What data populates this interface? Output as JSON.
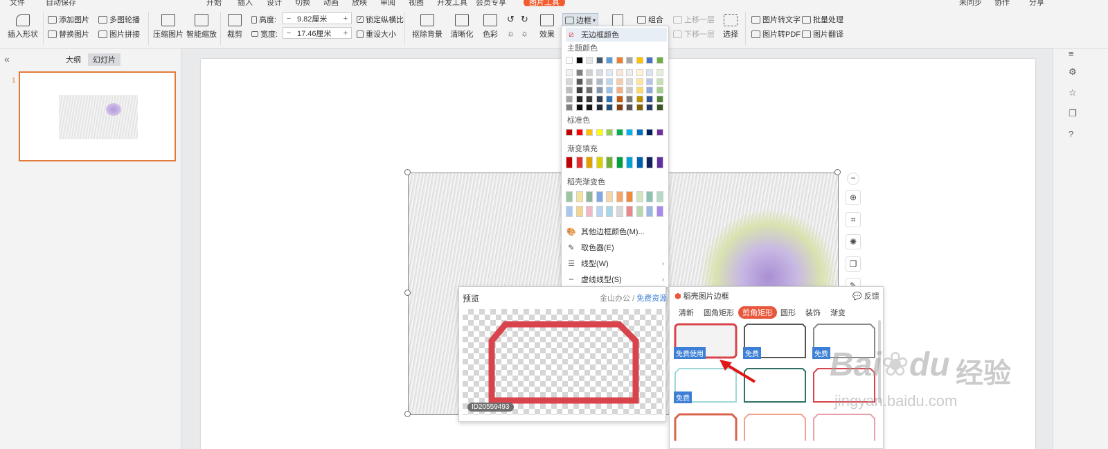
{
  "menubar": {
    "items": [
      "文件",
      "自动保存",
      "开始",
      "插入",
      "设计",
      "切换",
      "动画",
      "放映",
      "审阅",
      "视图",
      "开发工具",
      "会员专享",
      "图片工具"
    ],
    "right_items": [
      "未同步",
      "协作",
      "分享"
    ]
  },
  "ribbon": {
    "insert_shape": "插入形状",
    "add_picture": "添加图片",
    "replace_picture": "替换图片",
    "multi_carousel": "多图轮播",
    "picture_collage": "图片拼接",
    "compress": "压缩图片",
    "smart_zoom": "智能缩放",
    "crop": "裁剪",
    "height_label": "高度:",
    "height_value": "9.82厘米",
    "width_label": "宽度:",
    "width_value": "17.46厘米",
    "lock_ratio": "锁定纵横比",
    "reset_size": "重设大小",
    "remove_bg": "抠除背景",
    "sharpen": "清晰化",
    "color": "色彩",
    "effect": "效果",
    "border": "边框",
    "group": "组合",
    "bring_forward": "上移一层",
    "send_backward": "下移一层",
    "select": "选择",
    "img_to_text": "图片转文字",
    "batch": "批量处理",
    "img_to_pdf": "图片转PDF",
    "img_translate": "图片翻译",
    "minus": "−",
    "plus": "+"
  },
  "leftpanel": {
    "collapse": "«",
    "tab_outline": "大纲",
    "tab_slides": "幻灯片",
    "slide_number": "1"
  },
  "border_menu": {
    "no_border": "无边框颜色",
    "theme_colors": "主题颜色",
    "standard_colors": "标准色",
    "gradient_fill": "渐变填充",
    "daoke_gradient": "稻壳渐变色",
    "more_colors": "其他边框颜色(M)...",
    "eyedropper": "取色器(E)",
    "line_style": "线型(W)",
    "dash_style": "虚线线型(S)",
    "theme_row": [
      "#ffffff",
      "#000000",
      "#e7e6e6",
      "#44546a",
      "#5b9bd5",
      "#ed7d31",
      "#a5a5a5",
      "#ffc000",
      "#4472c4",
      "#70ad47"
    ],
    "theme_shades": [
      [
        "#f2f2f2",
        "#7f7f7f",
        "#d0cece",
        "#d6dce4",
        "#deebf6",
        "#fbe5d5",
        "#ededed",
        "#fff2cc",
        "#dae3f3",
        "#e2efd9"
      ],
      [
        "#d8d8d8",
        "#595959",
        "#aeabab",
        "#adb9ca",
        "#bdd7ee",
        "#f7cbac",
        "#dbdbdb",
        "#fee599",
        "#b4c6e7",
        "#c5e0b3"
      ],
      [
        "#bfbfbf",
        "#3f3f3f",
        "#757070",
        "#8496b0",
        "#9cc3e5",
        "#f4b183",
        "#c9c9c9",
        "#ffd965",
        "#8eaadb",
        "#a8d08d"
      ],
      [
        "#a5a5a5",
        "#262626",
        "#3a3838",
        "#323f4f",
        "#2e75b5",
        "#c55a11",
        "#7b7b7b",
        "#bf9000",
        "#2f5496",
        "#538135"
      ],
      [
        "#7f7f7f",
        "#0c0c0c",
        "#171616",
        "#222a35",
        "#1e4e79",
        "#833c0b",
        "#525252",
        "#7f6000",
        "#1f3864",
        "#375623"
      ]
    ],
    "standard_row": [
      "#c00000",
      "#ff0000",
      "#ffc000",
      "#ffff00",
      "#92d050",
      "#00b050",
      "#00b0f0",
      "#0070c0",
      "#002060",
      "#7030a0"
    ],
    "gradient_row": [
      "#c00000",
      "#e03030",
      "#e0a000",
      "#d8d000",
      "#70b030",
      "#00a040",
      "#00a0d8",
      "#0060b0",
      "#102060",
      "#6030a0"
    ],
    "daoke_row1": [
      "#9cc5a1",
      "#f6e39c",
      "#8fb59a",
      "#7fa9e0",
      "#f5d7a9",
      "#f3a76a",
      "#f08a3c",
      "#cfe6c0",
      "#8ac4b0",
      "#b8d8c8"
    ],
    "daoke_row2": [
      "#a9c8f0",
      "#f6d58a",
      "#f2b8c8",
      "#b9d4f2",
      "#a8d8e8",
      "#d8d8d8",
      "#e88888",
      "#b8d8b0",
      "#98b8e8",
      "#a888e8"
    ]
  },
  "preview": {
    "title": "预览",
    "source": "金山办公",
    "divider": "/",
    "free_resource": "免费资源",
    "id_badge": "ID20559493"
  },
  "frames": {
    "title": "稻壳图片边框",
    "feedback": "反馈",
    "tabs": [
      "清新",
      "圆角矩形",
      "剪角矩形",
      "圆形",
      "装饰",
      "渐变"
    ],
    "active_tab_index": 2,
    "badge_free_use": "免费使用",
    "badge_free": "免费"
  },
  "watermark": {
    "main": "Bai",
    "paw": "du",
    "cn": "经验",
    "url": "jingyan.baidu.com"
  },
  "colors": {
    "accent": "#f25c2e",
    "selection": "#e07b39",
    "badge": "#3d7fd6",
    "frame_red": "#d9434b",
    "link": "#3d7fd6"
  }
}
